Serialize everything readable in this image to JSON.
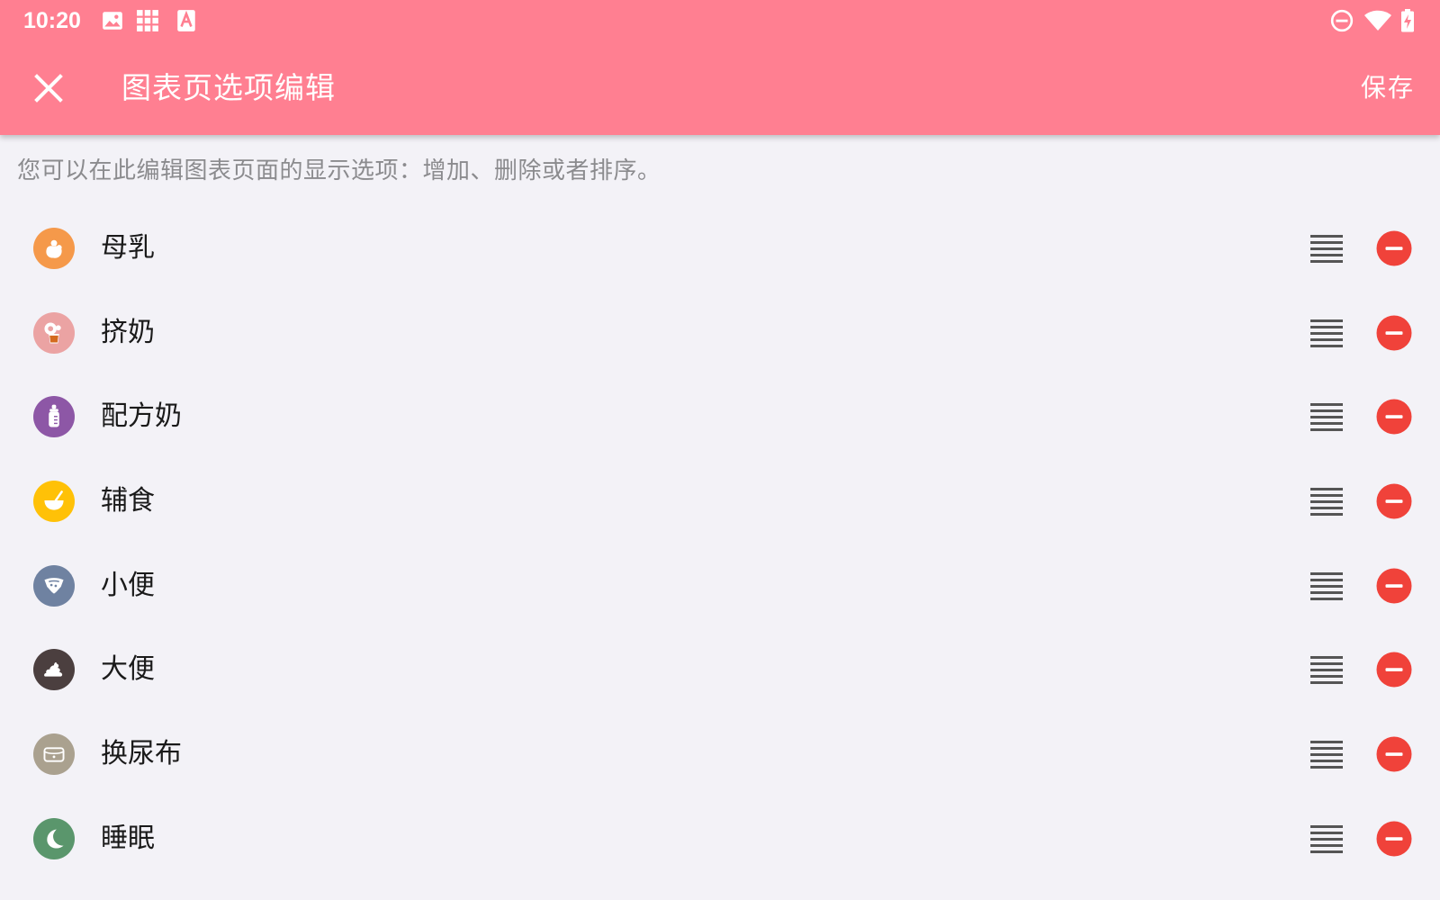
{
  "status_bar": {
    "time": "10:20",
    "left_icons": [
      "image-notification-icon",
      "grid-app-icon",
      "keyboard-a-icon"
    ],
    "right_icons": [
      "do-not-disturb-icon",
      "wifi-icon",
      "battery-charging-icon"
    ]
  },
  "toolbar": {
    "title": "图表页选项编辑",
    "save_label": "保存",
    "close_icon": "close-icon",
    "background_color": "#ff7f91"
  },
  "description": "您可以在此编辑图表页面的显示选项：增加、删除或者排序。",
  "items": [
    {
      "label": "母乳",
      "icon": "breastfeeding-icon",
      "color": "#f5994a"
    },
    {
      "label": "挤奶",
      "icon": "breast-pump-icon",
      "color": "#eba3a3"
    },
    {
      "label": "配方奶",
      "icon": "baby-bottle-icon",
      "color": "#8d57a6"
    },
    {
      "label": "辅食",
      "icon": "food-bowl-icon",
      "color": "#ffc107"
    },
    {
      "label": "小便",
      "icon": "wet-diaper-icon",
      "color": "#6f82a1"
    },
    {
      "label": "大便",
      "icon": "poop-icon",
      "color": "#4b3f3f"
    },
    {
      "label": "换尿布",
      "icon": "diaper-change-icon",
      "color": "#aaa18f"
    },
    {
      "label": "睡眠",
      "icon": "moon-sleep-icon",
      "color": "#5a966c"
    }
  ],
  "actions": {
    "drag_icon": "drag-handle-icon",
    "remove_icon": "remove-circle-icon",
    "remove_color": "#f0423a"
  }
}
